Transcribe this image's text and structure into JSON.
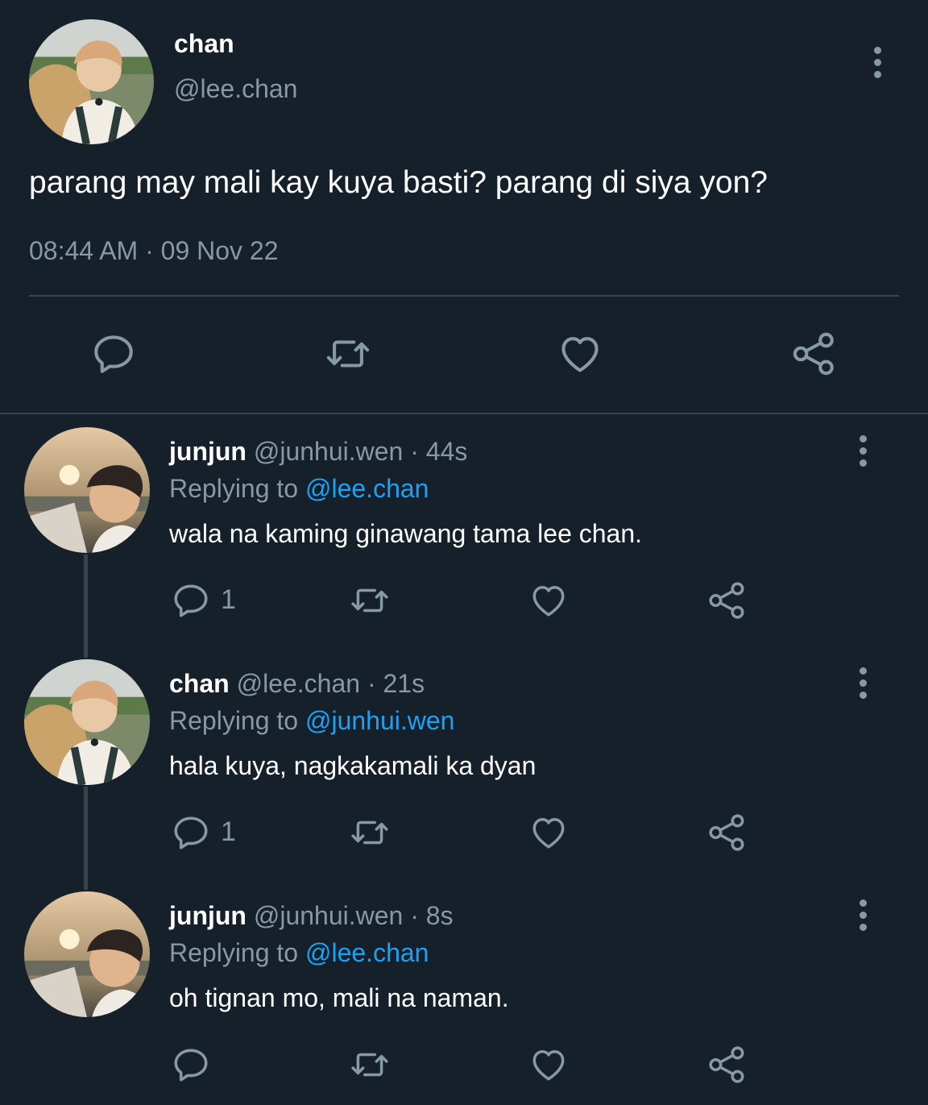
{
  "main_tweet": {
    "name": "chan",
    "handle": "@lee.chan",
    "text": "parang may mali kay kuya basti? parang di siya yon?",
    "timestamp": "08:44 AM · 09 Nov 22",
    "icons": [
      "reply-icon",
      "retweet-icon",
      "like-icon",
      "share-icon",
      "more-icon"
    ]
  },
  "replies": [
    {
      "name": "junjun",
      "meta": "@junhui.wen · 44s",
      "replying_label": "Replying to",
      "replying_to": "@lee.chan",
      "text": "wala na kaming ginawang tama lee chan.",
      "reply_count": "1"
    },
    {
      "name": "chan",
      "meta": "@lee.chan · 21s",
      "replying_label": "Replying to",
      "replying_to": "@junhui.wen",
      "text": "hala kuya, nagkakamali ka dyan",
      "reply_count": "1"
    },
    {
      "name": "junjun",
      "meta": "@junhui.wen · 8s",
      "replying_label": "Replying to",
      "replying_to": "@lee.chan",
      "text": "oh tignan mo, mali na naman.",
      "reply_count": ""
    }
  ],
  "colors": {
    "background": "#15202b",
    "secondary_text": "#8899a6",
    "mention": "#1da1f2",
    "divider": "#38444d"
  }
}
